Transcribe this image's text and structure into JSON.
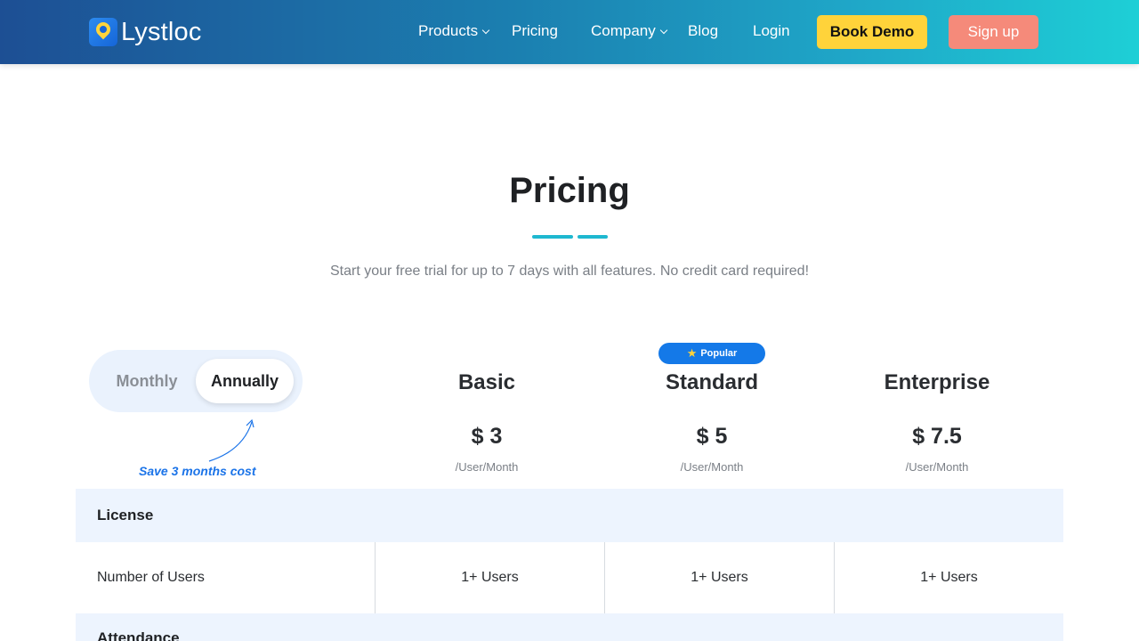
{
  "header": {
    "logo_text": "Lystloc",
    "nav": {
      "products": "Products",
      "pricing": "Pricing",
      "company": "Company",
      "blog": "Blog",
      "login": "Login"
    },
    "book_demo": "Book Demo",
    "sign_up": "Sign up"
  },
  "hero": {
    "title": "Pricing",
    "subtitle": "Start your free trial for up to 7 days with all features. No credit card required!"
  },
  "billing_toggle": {
    "monthly": "Monthly",
    "annually": "Annually",
    "selected": "Annually",
    "save_note": "Save 3 months cost"
  },
  "plans": [
    {
      "name": "Basic",
      "price": "$ 3",
      "unit": "/User/Month"
    },
    {
      "name": "Standard",
      "price": "$ 5",
      "unit": "/User/Month",
      "badge": "Popular"
    },
    {
      "name": "Enterprise",
      "price": "$ 7.5",
      "unit": "/User/Month"
    }
  ],
  "table": {
    "sections": [
      {
        "label": "License",
        "rows": [
          {
            "feature": "Number of Users",
            "values": [
              "1+ Users",
              "1+ Users",
              "1+ Users"
            ]
          }
        ]
      },
      {
        "label": "Attendance"
      }
    ]
  },
  "colors": {
    "accent": "#1eb8d0",
    "book_demo_bg": "#ffd33a",
    "sign_up_bg": "#f58a7a",
    "popular_badge": "#1479e8",
    "section_bg": "#edf4fe"
  }
}
